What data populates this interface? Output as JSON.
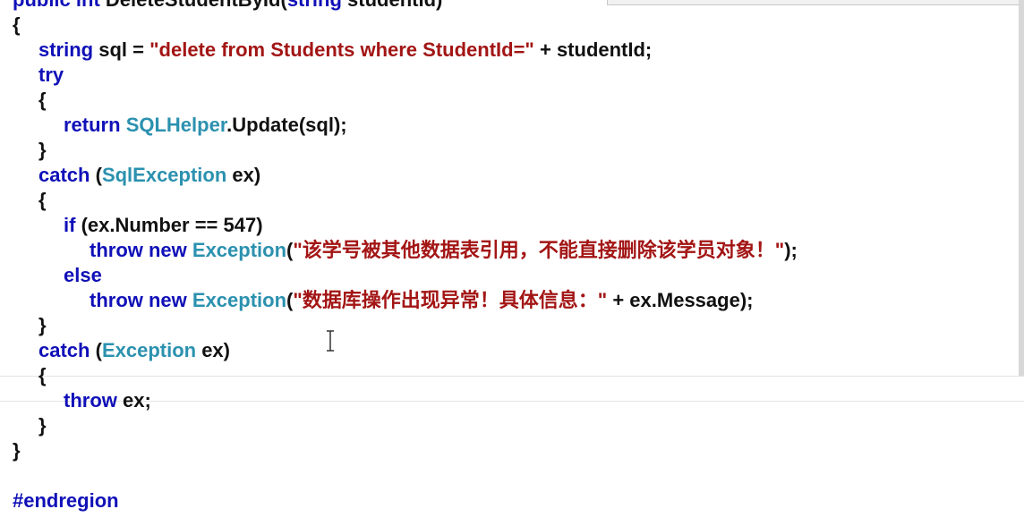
{
  "code": {
    "lines": [
      [
        {
          "t": "public int ",
          "c": "kw"
        },
        {
          "t": "DeleteStudentById(",
          "c": "txt"
        },
        {
          "t": "string",
          "c": "kw"
        },
        {
          "t": " studentId)",
          "c": "txt"
        }
      ],
      [
        {
          "t": "{",
          "c": "txt"
        }
      ],
      [
        {
          "t": "string",
          "c": "kw"
        },
        {
          "t": " sql = ",
          "c": "txt"
        },
        {
          "t": "\"delete from Students where StudentId=\"",
          "c": "str"
        },
        {
          "t": " + studentId;",
          "c": "txt"
        }
      ],
      [
        {
          "t": "try",
          "c": "kw"
        }
      ],
      [
        {
          "t": "{",
          "c": "txt"
        }
      ],
      [
        {
          "t": "return ",
          "c": "kw"
        },
        {
          "t": "SQLHelper",
          "c": "typ"
        },
        {
          "t": ".Update(sql);",
          "c": "txt"
        }
      ],
      [
        {
          "t": "}",
          "c": "txt"
        }
      ],
      [
        {
          "t": "catch",
          "c": "kw"
        },
        {
          "t": " (",
          "c": "txt"
        },
        {
          "t": "SqlException",
          "c": "typ"
        },
        {
          "t": " ex)",
          "c": "txt"
        }
      ],
      [
        {
          "t": "{",
          "c": "txt"
        }
      ],
      [
        {
          "t": "if",
          "c": "kw"
        },
        {
          "t": " (ex.Number == 547)",
          "c": "txt"
        }
      ],
      [
        {
          "t": "throw new ",
          "c": "kw"
        },
        {
          "t": "Exception",
          "c": "typ"
        },
        {
          "t": "(",
          "c": "txt"
        },
        {
          "t": "\"该学号被其他数据表引用，不能直接删除该学员对象！\"",
          "c": "str"
        },
        {
          "t": ");",
          "c": "txt"
        }
      ],
      [
        {
          "t": "else",
          "c": "kw"
        }
      ],
      [
        {
          "t": "throw new ",
          "c": "kw"
        },
        {
          "t": "Exception",
          "c": "typ"
        },
        {
          "t": "(",
          "c": "txt"
        },
        {
          "t": "\"数据库操作出现异常！具体信息：\"",
          "c": "str"
        },
        {
          "t": " + ex.Message);",
          "c": "txt"
        }
      ],
      [
        {
          "t": "}",
          "c": "txt"
        }
      ],
      [
        {
          "t": "catch",
          "c": "kw"
        },
        {
          "t": " (",
          "c": "txt"
        },
        {
          "t": "Exception",
          "c": "typ"
        },
        {
          "t": " ex)",
          "c": "txt"
        }
      ],
      [
        {
          "t": "{",
          "c": "txt"
        }
      ],
      [
        {
          "t": "throw",
          "c": "kw"
        },
        {
          "t": " ex;",
          "c": "txt"
        }
      ],
      [
        {
          "t": "}",
          "c": "txt"
        }
      ],
      [
        {
          "t": "}",
          "c": "txt"
        }
      ],
      [],
      [
        {
          "t": "#endregion",
          "c": "kw"
        }
      ]
    ]
  },
  "colors": {
    "keyword": "#1010b8",
    "string": "#a31515",
    "type": "#2b91af",
    "text": "#111111",
    "background": "#ffffff"
  },
  "icons": {
    "text_cursor": "i-beam-cursor-icon"
  }
}
